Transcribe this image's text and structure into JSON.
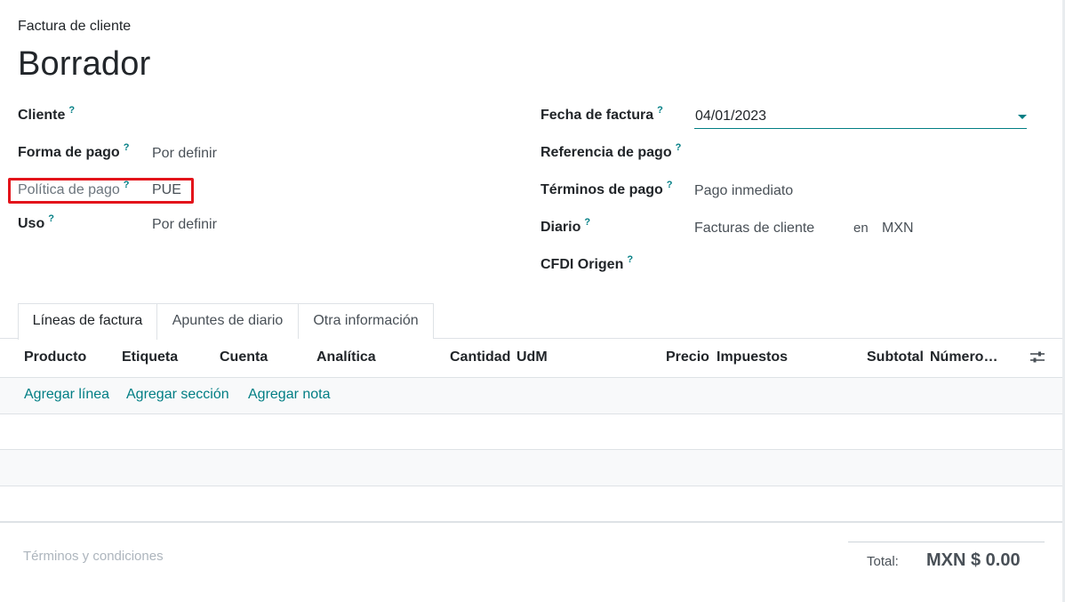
{
  "header": {
    "doc_type": "Factura de cliente",
    "status_title": "Borrador"
  },
  "left_fields": {
    "cliente": {
      "label": "Cliente",
      "value": ""
    },
    "forma_pago": {
      "label": "Forma de pago",
      "value": "Por definir"
    },
    "politica_pago": {
      "label": "Política de pago",
      "value": "PUE"
    },
    "uso": {
      "label": "Uso",
      "value": "Por definir"
    }
  },
  "right_fields": {
    "fecha_factura": {
      "label": "Fecha de factura",
      "value": "04/01/2023"
    },
    "referencia_pago": {
      "label": "Referencia de pago",
      "value": ""
    },
    "terminos_pago": {
      "label": "Términos de pago",
      "value": "Pago inmediato"
    },
    "diario": {
      "label": "Diario",
      "value": "Facturas de cliente",
      "connector": "en",
      "currency": "MXN"
    },
    "cfdi_origen": {
      "label": "CFDI Origen",
      "value": ""
    }
  },
  "help_marker": "?",
  "tabs": [
    {
      "label": "Líneas de factura",
      "active": true
    },
    {
      "label": "Apuntes de diario",
      "active": false
    },
    {
      "label": "Otra información",
      "active": false
    }
  ],
  "table": {
    "columns": [
      "Producto",
      "Etiqueta",
      "Cuenta",
      "Analítica",
      "Cantidad",
      "UdM",
      "Precio",
      "Impuestos",
      "Subtotal",
      "Número…"
    ],
    "settings_icon": "sliders-icon",
    "add_links": [
      "Agregar línea",
      "Agregar sección",
      "Agregar nota"
    ]
  },
  "footer": {
    "terms_placeholder": "Términos y condiciones",
    "total_label": "Total:",
    "total_value": "MXN $ 0.00"
  },
  "colors": {
    "accent": "#017e84",
    "highlight": "#e3141b",
    "border": "#dee2e6"
  }
}
